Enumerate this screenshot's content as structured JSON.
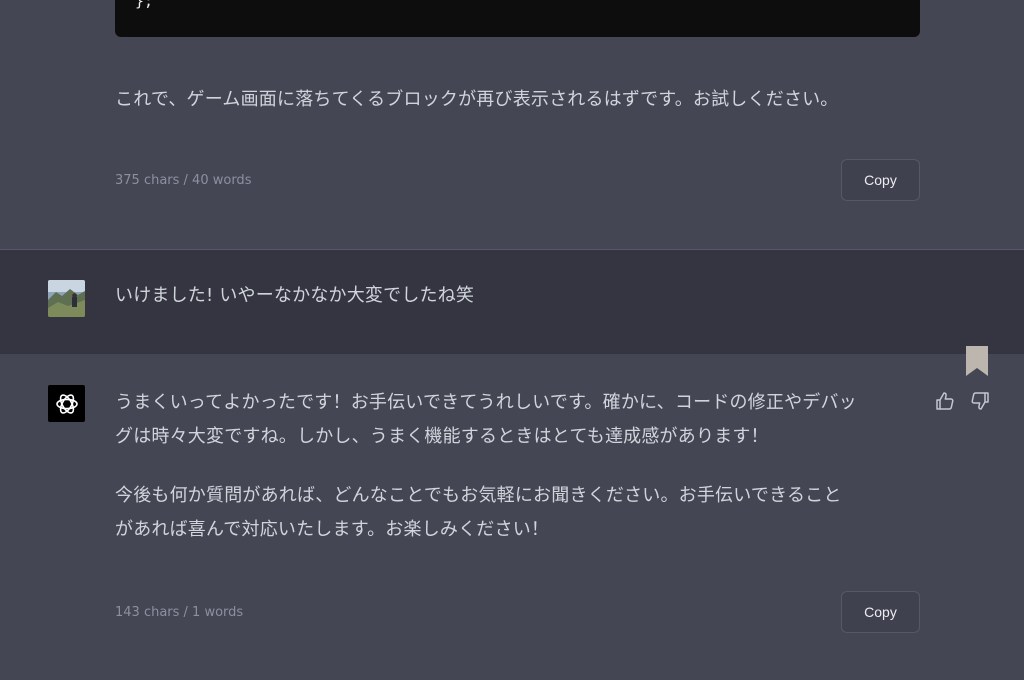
{
  "code_block": {
    "last_line": "};"
  },
  "assistant_message_1": {
    "text": "これで、ゲーム画面に落ちてくるブロックが再び表示されるはずです。お試しください。",
    "char_count": "375 chars / 40 words",
    "copy_label": "Copy"
  },
  "user_message": {
    "text": "いけました! いやーなかなか大変でしたね笑"
  },
  "assistant_message_2": {
    "paragraphs": [
      "うまくいってよかったです！お手伝いできてうれしいです。確かに、コードの修正やデバッ",
      "グは時々大変ですね。しかし、うまく機能するときはとても達成感があります！",
      "今後も何か質問があれば、どんなことでもお気軽にお聞きください。お手伝いできること",
      "があれば喜んで対応いたします。お楽しみください！"
    ],
    "char_count": "143 chars / 1 words",
    "copy_label": "Copy"
  },
  "icons": {
    "bookmark": "bookmark-icon",
    "thumbs_up": "thumbs-up-icon",
    "thumbs_down": "thumbs-down-icon",
    "assistant_logo": "openai-logo-icon",
    "user_avatar": "user-avatar"
  },
  "colors": {
    "assistant_bg": "#444654",
    "user_bg": "#343541",
    "code_bg": "#0d0d0d",
    "text": "#d1d5db",
    "muted": "#8e8ea0",
    "bookmark": "#bdb6ae"
  }
}
